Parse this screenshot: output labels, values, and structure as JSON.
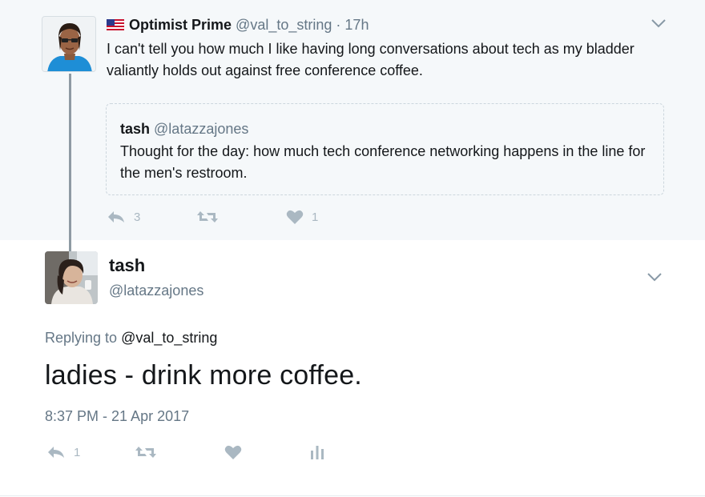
{
  "parent": {
    "name": "Optimist Prime",
    "handle": "@val_to_string",
    "separator": "·",
    "time": "17h",
    "text": "I can't tell you how much I like having long conversations about tech as my bladder valiantly holds out against free conference coffee.",
    "quote": {
      "name": "tash",
      "handle": "@latazzajones",
      "text": "Thought for the day: how much tech conference networking happens in the line for the men's restroom."
    },
    "actions": {
      "reply_count": "3",
      "like_count": "1"
    },
    "flag_icon": "us-flag-icon"
  },
  "main": {
    "name": "tash",
    "handle": "@latazzajones",
    "replying_prefix": "Replying to",
    "replying_handle": "@val_to_string",
    "text": "ladies - drink more coffee.",
    "date": "8:37 PM - 21 Apr 2017",
    "actions": {
      "reply_count": "1"
    }
  },
  "colors": {
    "parent_background": "#f5f8fa",
    "secondary_text": "#657786",
    "action_icon": "#aab8c2",
    "thread_line": "#8e9aa3"
  }
}
